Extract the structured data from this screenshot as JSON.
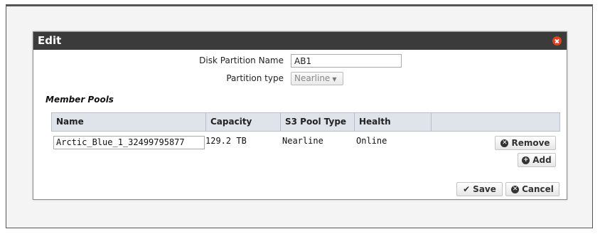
{
  "dialog": {
    "title": "Edit",
    "close_icon": "close-icon"
  },
  "form": {
    "partition_name_label": "Disk Partition Name",
    "partition_name_value": "AB1",
    "partition_type_label": "Partition type",
    "partition_type_value": "Nearline",
    "partition_type_arrow": "▼"
  },
  "member_pools": {
    "heading": "Member Pools",
    "columns": [
      "Name",
      "Capacity",
      "S3 Pool Type",
      "Health"
    ],
    "rows": [
      {
        "name": "Arctic_Blue_1_32499795877",
        "capacity": "129.2 TB",
        "pool_type": "Nearline",
        "health": "Online"
      }
    ],
    "remove_label": "Remove",
    "add_label": "Add"
  },
  "footer": {
    "save_label": "Save",
    "cancel_label": "Cancel"
  },
  "icons": {
    "remove": "remove-circle-icon",
    "add": "add-circle-icon",
    "save": "check-icon",
    "cancel": "cancel-circle-icon"
  },
  "colors": {
    "titlebar": "#3b3b3b",
    "close": "#e0401f",
    "table_header": "#dfe3ea"
  }
}
